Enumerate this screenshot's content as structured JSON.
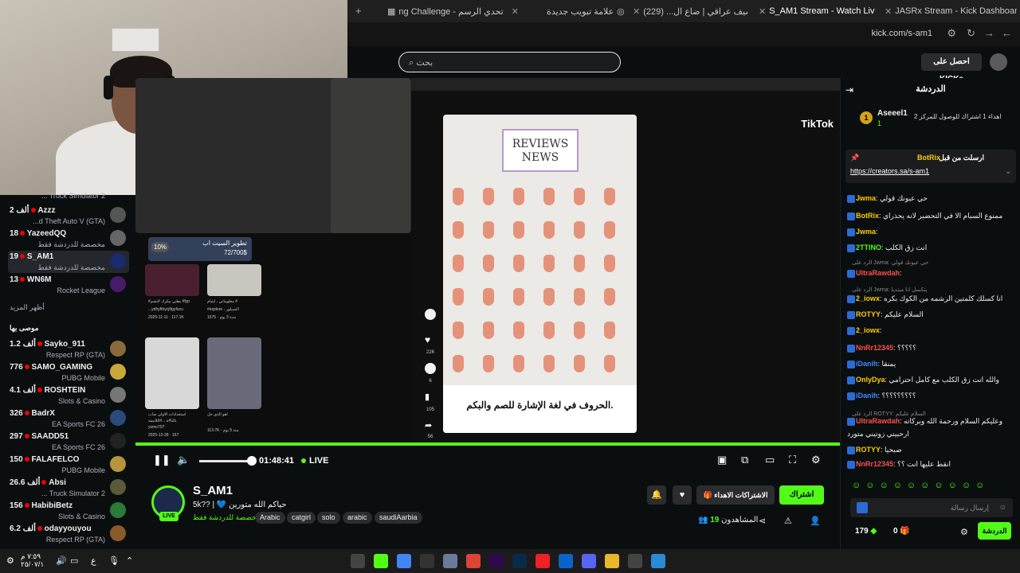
{
  "browser": {
    "tabs": [
      {
        "label": "ng Challenge - تحدي الرسم",
        "icon": "generic-tab-icon",
        "active": false
      },
      {
        "label": "علامة تبويب جديدة",
        "icon": "chrome-icon",
        "active": false
      },
      {
        "label": "ارشيف عراقي | ضاع ال... (229)",
        "icon": "youtube-icon",
        "active": false
      },
      {
        "label": "S_AM1 Stream - Watch Live",
        "icon": "kick-icon",
        "active": true
      },
      {
        "label": "JASRx Stream - Kick Dashboard",
        "icon": "kick-icon",
        "active": false
      }
    ],
    "url": "kick.com/s-am1"
  },
  "header": {
    "search_placeholder": "بحث",
    "get_kicks": "احصل على KICKs"
  },
  "sidebar": {
    "items_top": [
      {
        "viewers": "2 ألف",
        "name": "Azzz",
        "sub": "...d Theft Auto V (GTA)"
      },
      {
        "viewers": "18",
        "name": "YazeedQQ",
        "sub": "مخصصة للدردشة فقط"
      },
      {
        "viewers": "19",
        "name": "S_AM1",
        "sub": "مخصصة للدردشة فقط",
        "active": true
      },
      {
        "viewers": "13",
        "name": "WN6M",
        "sub": "Rocket League"
      }
    ],
    "truncated_top": "... Truck Simulator 2",
    "show_more": "أظهر المزيد",
    "recommended_title": "موصى بها",
    "items_recommended": [
      {
        "viewers": "1.2 ألف",
        "name": "Sayko_911",
        "sub": "Respect RP (GTA)"
      },
      {
        "viewers": "776",
        "name": "SAMO_GAMING",
        "sub": "PUBG Mobile"
      },
      {
        "viewers": "4.1 ألف",
        "name": "ROSHTEIN",
        "sub": "Slots & Casino"
      },
      {
        "viewers": "326",
        "name": "BadrX",
        "sub": "EA Sports FC 26"
      },
      {
        "viewers": "297",
        "name": "SAADD51",
        "sub": "EA Sports FC 26"
      },
      {
        "viewers": "150",
        "name": "FALAFELCO",
        "sub": "PUBG Mobile"
      },
      {
        "viewers": "26.6 ألف",
        "name": "Absi",
        "sub": "... Truck Simulator 2"
      },
      {
        "viewers": "156",
        "name": "HabibiBetz",
        "sub": "Slots & Casino"
      },
      {
        "viewers": "6.2 ألف",
        "name": "odayyouyou",
        "sub": "Respect RP (GTA)"
      }
    ]
  },
  "video": {
    "tiktok_logo": "TikTok",
    "card_header": "REVIEWS NEWS",
    "card_caption": "الحروف في لغة الإشارة للصم والبكم.",
    "promo_title": "تطوير السيت اب",
    "promo_progress": "72/700$",
    "promo_percent": "10%",
    "side_counts": [
      "226",
      "6",
      "105",
      "56"
    ],
    "left_captions": [
      "#بطني بيكرك #بشم #fyp",
      "...ydhyfthycjtfgyfucu",
      "2025-11-11 · 117.1K",
      "معلوماتي ، ايتيام #",
      "#explore ، اكسبلور",
      "1675 · مدة 3 يوم",
      "استعدادات الاولى ساب",
      "يالنا#ة ...#اللاتيمه",
      "ysmo707",
      "2025-12-28 · 167",
      "اهو الذي حل",
      "113.7K · منذ 5 يوم"
    ]
  },
  "controls": {
    "time": "01:48:41",
    "live": "LIVE",
    "progress": 0.8
  },
  "stream": {
    "name": "S_AM1",
    "title": "5k?? | 💙 حياكم الله متورين",
    "category": "مخصصة للدردشة فقط",
    "tags": [
      "Arabic",
      "catgirl",
      "solo",
      "arabic",
      "saudiAarbia"
    ],
    "follow": "اشتراك",
    "gift_subs": "الاشتراكات الاهداء",
    "viewers_label": "المشاهدون",
    "viewers": "19"
  },
  "chat": {
    "title": "الدردشة",
    "top_gifter": {
      "rank": "1",
      "name": "Aseeel1",
      "count": "1",
      "text": "اهداء 1 اشتراك للوصول للمركز 2"
    },
    "pinned": {
      "label": "ارسلت من قبل",
      "user": "BotRix",
      "link": "https://creators.sa/s-am1"
    },
    "messages": [
      {
        "user": "Jwma",
        "text": "حي عيونك قولي",
        "color": "#ffcc00"
      },
      {
        "user": "BotRix",
        "text": "ممنوع السبام الا في التحضير لانه يحذراي",
        "color": "#ffcc00"
      },
      {
        "user": "Jwma",
        "text": "",
        "color": "#ffcc00"
      },
      {
        "user": "2TTINO",
        "text": "انت زق الكلب",
        "color": "#53fc18"
      },
      {
        "user": "UltraRawdah",
        "text": "",
        "color": "#ff4d4d"
      },
      {
        "user": "2_iowx",
        "text": "انا كسلك كلمتين الرشمه من الكوك بكره",
        "color": "#ffcc00"
      },
      {
        "user": "ROTYY",
        "text": "السلام عليكم",
        "color": "#ffcc00"
      },
      {
        "user": "2_iowx",
        "text": "",
        "color": "#ffcc00"
      },
      {
        "user": "NnRr12345",
        "text": "؟؟؟؟؟",
        "color": "#ff4d4d"
      },
      {
        "user": "iDanih",
        "text": "يمنقا",
        "color": "#3d8bff"
      },
      {
        "user": "OnlyDya",
        "text": "والله انت زق الكلب مع كامل احترامي",
        "color": "#ffcc00"
      },
      {
        "user": "iDanih",
        "text": "؟؟؟؟؟؟؟؟؟",
        "color": "#3d8bff"
      },
      {
        "user": "UltraRawdah",
        "text": "وعليكم السلام ورحمة الله وبركاته",
        "color": "#ff4d4d"
      },
      {
        "user": "ROTYY",
        "text": "صبحيا",
        "color": "#ffcc00"
      },
      {
        "user": "NnRr12345",
        "text": "انقط عليها انت ؟؟",
        "color": "#ff4d4d"
      }
    ],
    "replies": [
      "الرد على Jwma: حي عيونك قولي",
      "الرد على Jwma: يتكسل انا مبتديا",
      "الرد على ROTYY: السلام عليكم"
    ],
    "extra_line": "ارحبيني زوتيني متورد",
    "input_placeholder": "إرسال رسالة",
    "send": "الدردشة",
    "kicks": "179",
    "subs": "0"
  },
  "taskbar": {
    "clock_time": "٧:٥٩ م",
    "clock_date": "٢٥/٠٧/١"
  }
}
